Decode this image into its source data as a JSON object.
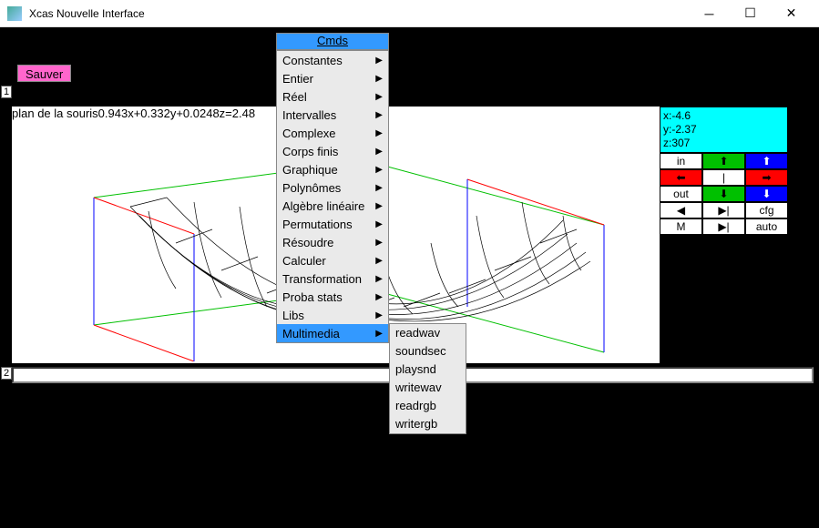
{
  "window": {
    "title": "Xcas Nouvelle Interface"
  },
  "toolbar": {
    "cmds": "Cmds",
    "sauver": "Sauver"
  },
  "rows": {
    "r1": "1",
    "r2": "2"
  },
  "plot": {
    "label": "plan de la souris0.943x+0.332y+0.0248z=2.48"
  },
  "menu": {
    "items": [
      "Constantes",
      "Entier",
      "Réel",
      "Intervalles",
      "Complexe",
      "Corps finis",
      "Graphique",
      "Polynômes",
      "Algèbre linéaire",
      "Permutations",
      "Résoudre",
      "Calculer",
      "Transformation",
      "Proba stats",
      "Libs",
      "Multimedia"
    ],
    "highlighted_index": 15
  },
  "submenu": {
    "items": [
      "readwav",
      "soundsec",
      "playsnd",
      "writewav",
      "readrgb",
      "writergb"
    ]
  },
  "coords": {
    "x": "x:-4.6",
    "y": "y:-2.37",
    "z": "z:307"
  },
  "controls": {
    "in": "in",
    "out": "out",
    "cfg": "cfg",
    "M": "M",
    "auto": "auto",
    "up": "⬆",
    "down": "⬇",
    "left": "⬅",
    "right": "➡",
    "pipe": "|",
    "bar": "⬛→",
    "lfine": "◀",
    "rfine": "▶"
  }
}
